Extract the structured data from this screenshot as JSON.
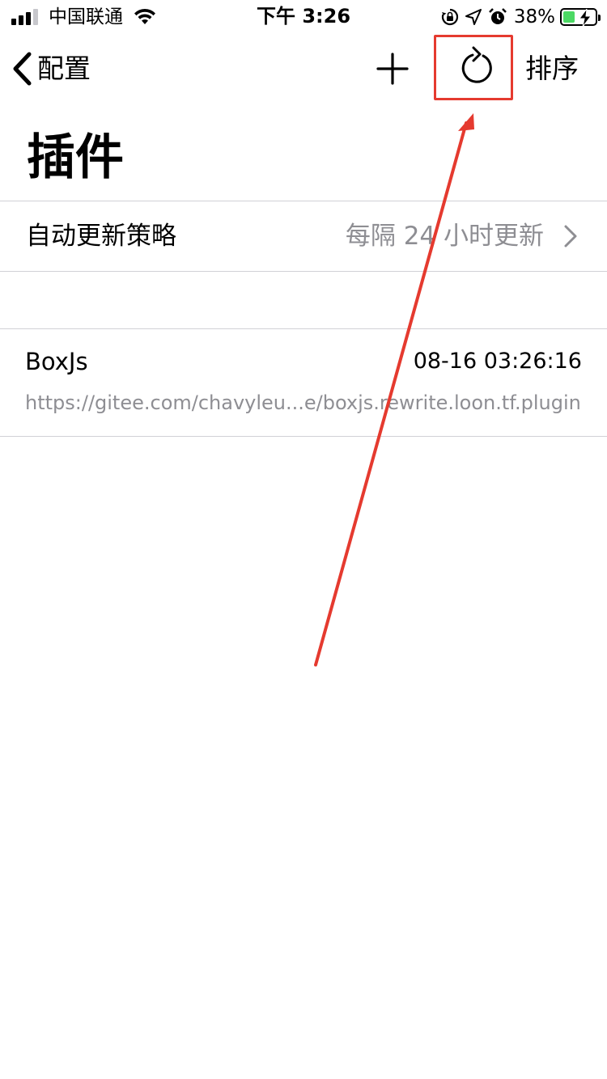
{
  "status_bar": {
    "carrier": "中国联通",
    "time": "下午 3:26",
    "battery_percent": "38%",
    "battery_level": 0.38,
    "icons": [
      "signal-icon",
      "wifi-icon",
      "orientation-lock-icon",
      "location-icon",
      "alarm-icon",
      "battery-icon"
    ]
  },
  "nav": {
    "back_label": "配置",
    "add_icon": "plus-icon",
    "refresh_icon": "refresh-icon",
    "sort_label": "排序"
  },
  "page": {
    "title": "插件"
  },
  "settings": {
    "auto_update_label": "自动更新策略",
    "auto_update_value": "每隔 24 小时更新"
  },
  "plugins": [
    {
      "name": "BoxJs",
      "updated": "08-16 03:26:16",
      "url": "https://gitee.com/chavyleu...e/boxjs.rewrite.loon.tf.plugin"
    }
  ],
  "annotation": {
    "color": "#e53a2f"
  }
}
